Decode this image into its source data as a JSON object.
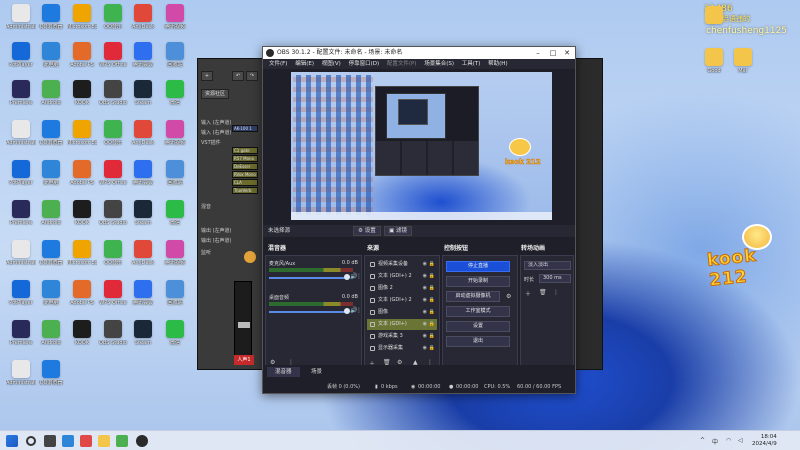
{
  "watermark": {
    "top": "11486",
    "line2": "情你侣语违的",
    "user": "chenfusheng1125",
    "brand": "kook 212",
    "preview_brand": "kook 212"
  },
  "desktop_icons": [
    {
      "label": "Administrator",
      "color": "#e8e8e8"
    },
    {
      "label": "QQ浏览器",
      "color": "#1f7ae0"
    },
    {
      "label": "Microsoft Edge",
      "color": "#f0a400"
    },
    {
      "label": "QQ音乐",
      "color": "#3fb34f"
    },
    {
      "label": "AnyDesk",
      "color": "#e0483a"
    },
    {
      "label": "腾讯视频",
      "color": "#d14aa8"
    },
    {
      "label": "PotPlayer",
      "color": "#1468d8"
    },
    {
      "label": "此电脑",
      "color": "#2f86d8"
    },
    {
      "label": "Adobe PS",
      "color": "#e46a2a"
    },
    {
      "label": "WPS Office",
      "color": "#e02a3a"
    },
    {
      "label": "腾讯会议",
      "color": "#2e6ff0"
    },
    {
      "label": "回收站",
      "color": "#4d8fd8"
    },
    {
      "label": "Premiere",
      "color": "#2a2a5a"
    },
    {
      "label": "Android",
      "color": "#4caf50"
    },
    {
      "label": "KOOK",
      "color": "#1d1d1d"
    },
    {
      "label": "OBS Studio",
      "color": "#444"
    },
    {
      "label": "Steam",
      "color": "#1b2838"
    },
    {
      "label": "微信",
      "color": "#2dbb47"
    }
  ],
  "obs": {
    "title": "OBS 30.1.2 - 配置文件: 未命名 - 场景: 未命名",
    "menu": [
      "文件(F)",
      "编辑(E)",
      "视图(V)",
      "停靠窗口(D)",
      "配置文件(P)",
      "场景集合(S)",
      "工具(T)",
      "帮助(H)"
    ],
    "source_bar": {
      "label": "未选择源",
      "settings": "设置",
      "filters": "滤镜"
    },
    "docks": {
      "mixer": "混音器",
      "sources": "来源",
      "controls": "控制按钮",
      "transitions": "转场动画"
    },
    "mixer": [
      {
        "name": "麦克风/Aux",
        "db": "0.0 dB"
      },
      {
        "name": "桌面音频",
        "db": "0.0 dB"
      }
    ],
    "sources": [
      {
        "name": "视频采集设备",
        "selected": false
      },
      {
        "name": "文本 (GDI+) 2",
        "selected": false
      },
      {
        "name": "图像 2",
        "selected": false
      },
      {
        "name": "文本 (GDI+) 2",
        "selected": false
      },
      {
        "name": "图像",
        "selected": false
      },
      {
        "name": "文本 (GDI+)",
        "selected": true
      },
      {
        "name": "游戏采集 3",
        "selected": false
      },
      {
        "name": "显示器采集",
        "selected": false
      }
    ],
    "controls": [
      "停止直播",
      "开始录制",
      "启动虚拟摄像机",
      "工作室模式",
      "设置",
      "退出"
    ],
    "transitions": {
      "type": "淡入淡出",
      "duration_label": "时长",
      "duration": "300 ms"
    },
    "tabs": [
      "混音器",
      "场景"
    ],
    "status": {
      "dropped": "丢帧 0 (0.0%)",
      "kbps": "0 kbps",
      "live": "00:00:00",
      "rec": "00:00:00",
      "cpu": "CPU: 0.5%",
      "fps": "60.00 / 60.00 FPS"
    }
  },
  "audio_app": {
    "tab": "资源社区",
    "rows": [
      "输入 (左声道)",
      "输入 (右声道)",
      "VST插件",
      "混音",
      "输出 (左声道)",
      "输出 (右声道)",
      "监听"
    ],
    "slots": [
      "AK-100 1",
      "C1 gate Mono",
      "R57 Mono",
      "DeEsser Mono",
      "RVox Mono",
      "CLA",
      "TrueVerb Mono"
    ],
    "meter": "人声1"
  },
  "taskbar": {
    "time": "18:04",
    "date": "2024/4/9"
  }
}
